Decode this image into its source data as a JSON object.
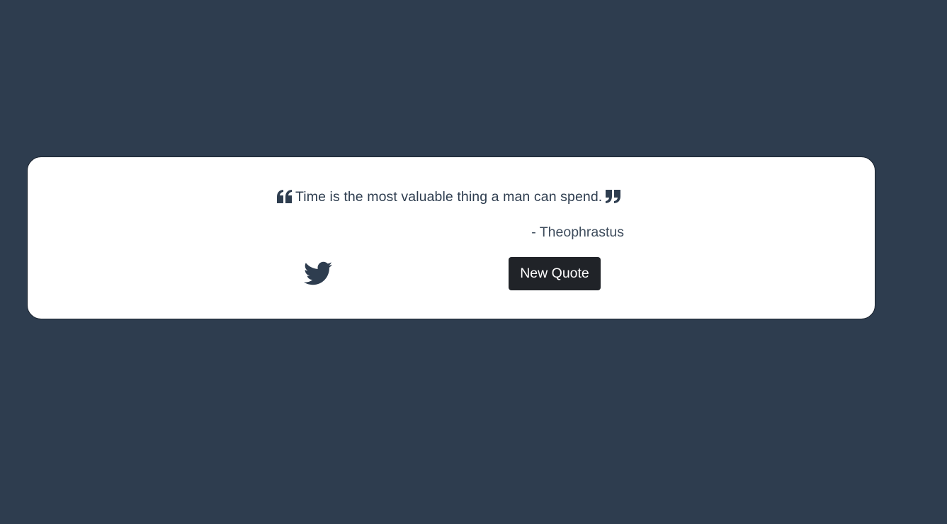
{
  "quote": {
    "text": "Time is the most valuable thing a man can spend.",
    "author": "- Theophrastus",
    "open_icon": "quote-left-icon",
    "close_icon": "quote-right-icon"
  },
  "actions": {
    "tweet_icon": "twitter-icon",
    "new_quote_label": "New Quote"
  },
  "colors": {
    "background": "#2e3d4f",
    "card": "#ffffff",
    "text": "#2e3d4f",
    "button": "#202328",
    "button_text": "#ffffff"
  }
}
